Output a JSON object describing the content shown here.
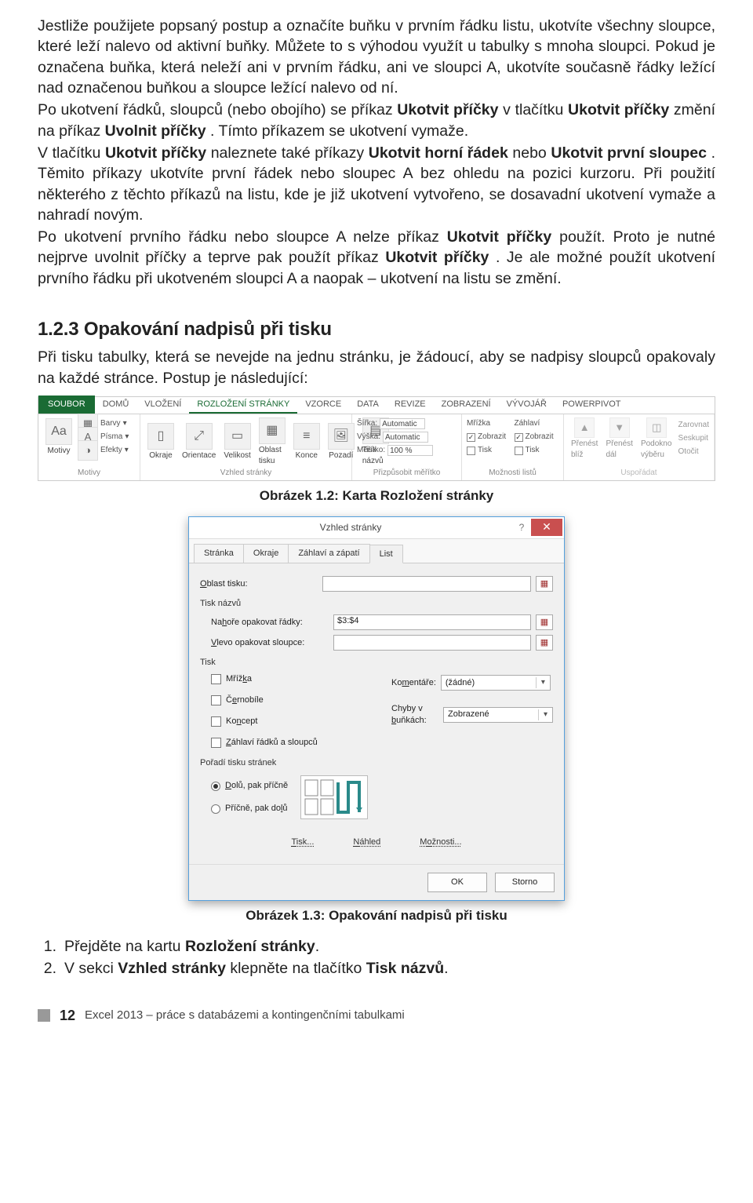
{
  "para1": "Jestliže použijete popsaný postup a označíte buňku v prvním řádku listu, ukotvíte všechny sloupce, které leží nalevo od aktivní buňky. Můžete to s výhodou využít u tabulky s mnoha sloupci. Pokud je označena buňka, která neleží ani v prvním řádku, ani ve sloupci A, ukotvíte současně řádky ležící nad označenou buňkou a sloupce ležící nalevo od ní.",
  "para2a": "Po ukotvení řádků, sloupců (nebo obojího) se příkaz ",
  "para2b": "Ukotvit příčky",
  "para2c": " v tlačítku ",
  "para2d": "Ukotvit příčky",
  "para2e": " změní na příkaz ",
  "para2f": "Uvolnit příčky",
  "para2g": ". Tímto příkazem se ukotvení vymaže.",
  "para3a": "V tlačítku ",
  "para3b": "Ukotvit příčky",
  "para3c": " naleznete také příkazy ",
  "para3d": "Ukotvit horní řádek",
  "para3e": " nebo ",
  "para3f": "Ukotvit první sloupec",
  "para3g": ". Těmito příkazy ukotvíte první řádek nebo sloupec A bez ohledu na pozici kurzoru. Při použití některého z těchto příkazů na listu, kde je již ukotvení vytvořeno, se dosavadní ukotvení vymaže a nahradí novým.",
  "para4a": "Po ukotvení prvního řádku nebo sloupce A nelze příkaz ",
  "para4b": "Ukotvit příčky",
  "para4c": " použít. Proto je nutné nejprve uvolnit příčky a teprve pak použít příkaz ",
  "para4d": "Ukotvit příčky",
  "para4e": ". Je ale možné použít ukotvení prvního řádku při ukotveném sloupci A a naopak – ukotvení na listu se změní.",
  "section_heading": "1.2.3   Opakování nadpisů při tisku",
  "para5": "Při tisku tabulky, která se nevejde na jednu stránku, je žádoucí, aby se nadpisy sloupců opakovaly na každé stránce. Postup je následující:",
  "ribbon": {
    "tabs": [
      "SOUBOR",
      "DOMŮ",
      "VLOŽENÍ",
      "ROZLOŽENÍ STRÁNKY",
      "VZORCE",
      "DATA",
      "REVIZE",
      "ZOBRAZENÍ",
      "VÝVOJÁŘ",
      "POWERPIVOT"
    ],
    "g_motivy": {
      "label": "Motivy",
      "motivy": "Motivy",
      "barvy": "Barvy",
      "pisma": "Písma",
      "efekty": "Efekty"
    },
    "g_vzhled": {
      "label": "Vzhled stránky",
      "okraje": "Okraje",
      "orientace": "Orientace",
      "velikost": "Velikost",
      "oblast": "Oblast tisku",
      "konce": "Konce",
      "pozadi": "Pozadí",
      "tisk": "Tisk názvů"
    },
    "g_prizp": {
      "label": "Přizpůsobit měřítko",
      "sirka": "Šířka:",
      "vyska": "Výška:",
      "meritko": "Měřítko:",
      "auto": "Automatic",
      "pct": "100 %"
    },
    "g_moznosti": {
      "label": "Možnosti listů",
      "mrizka": "Mřížka",
      "zahlavi": "Záhlaví",
      "zobrazit": "Zobrazit",
      "tisk": "Tisk"
    },
    "g_usporadat": {
      "label": "Uspořádat",
      "prenest": "Přenést blíž",
      "prenestdal": "Přenést dál",
      "podokno": "Podokno výběru",
      "zarovnat": "Zarovnat",
      "seskupit": "Seskupit",
      "otocit": "Otočit"
    }
  },
  "caption1": "Obrázek 1.2: Karta Rozložení stránky",
  "dialog": {
    "title": "Vzhled stránky",
    "tabs": [
      "Stránka",
      "Okraje",
      "Záhlaví a zápatí",
      "List"
    ],
    "oblast_label": "Oblast tisku:",
    "tisk_nazvu": "Tisk názvů",
    "nahore_label": "Nahoře opakovat řádky:",
    "nahore_value": "$3:$4",
    "vlevo_label": "Vlevo opakovat sloupce:",
    "tisk": "Tisk",
    "mrizka": "Mřížka",
    "cernobile": "Černobíle",
    "koncept": "Koncept",
    "zahlavi_radku": "Záhlaví řádků a sloupců",
    "komentare_label": "Komentáře:",
    "komentare_value": "(žádné)",
    "chyby_label": "Chyby v buňkách:",
    "chyby_value": "Zobrazené",
    "poradi": "Pořadí tisku stránek",
    "opt1": "Dolů, pak příčně",
    "opt2": "Příčně, pak dolů",
    "btn_tisk": "Tisk...",
    "btn_nahled": "Náhled",
    "btn_moznosti": "Možnosti...",
    "ok": "OK",
    "storno": "Storno"
  },
  "caption2": "Obrázek 1.3: Opakování nadpisů při tisku",
  "steps": {
    "s1a": "Přejděte na kartu ",
    "s1b": "Rozložení stránky",
    "s1c": ".",
    "s2a": "V sekci ",
    "s2b": "Vzhled stránky",
    "s2c": " klepněte na tlačítko ",
    "s2d": "Tisk názvů",
    "s2e": "."
  },
  "footer": {
    "page": "12",
    "title": "Excel 2013 – práce s databázemi a kontingenčními tabulkami"
  }
}
